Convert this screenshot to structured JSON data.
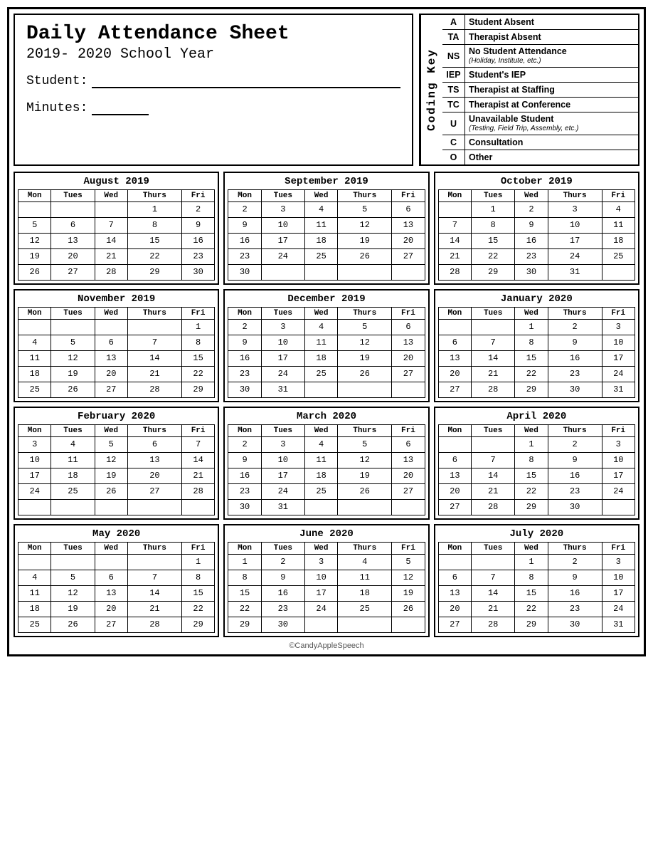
{
  "header": {
    "title": "Daily Attendance Sheet",
    "year": "2019- 2020 School Year",
    "student_label": "Student:",
    "minutes_label": "Minutes:"
  },
  "coding_key": {
    "label": "Coding Key",
    "items": [
      {
        "code": "A",
        "main": "Student Absent",
        "sub": ""
      },
      {
        "code": "TA",
        "main": "Therapist Absent",
        "sub": ""
      },
      {
        "code": "NS",
        "main": "No Student Attendance",
        "sub": "(Holiday, Institute, etc.)"
      },
      {
        "code": "IEP",
        "main": "Student's IEP",
        "sub": ""
      },
      {
        "code": "TS",
        "main": "Therapist at Staffing",
        "sub": ""
      },
      {
        "code": "TC",
        "main": "Therapist at Conference",
        "sub": ""
      },
      {
        "code": "U",
        "main": "Unavailable Student",
        "sub": "(Testing, Field Trip, Assembly, etc.)"
      },
      {
        "code": "C",
        "main": "Consultation",
        "sub": ""
      },
      {
        "code": "O",
        "main": "Other",
        "sub": ""
      }
    ]
  },
  "calendars": [
    {
      "title": "August 2019",
      "days": [
        "Mon",
        "Tues",
        "Wed",
        "Thurs",
        "Fri"
      ],
      "weeks": [
        [
          "",
          "",
          "",
          "1",
          "2"
        ],
        [
          "5",
          "6",
          "7",
          "8",
          "9"
        ],
        [
          "12",
          "13",
          "14",
          "15",
          "16"
        ],
        [
          "19",
          "20",
          "21",
          "22",
          "23"
        ],
        [
          "26",
          "27",
          "28",
          "29",
          "30"
        ]
      ]
    },
    {
      "title": "September 2019",
      "days": [
        "Mon",
        "Tues",
        "Wed",
        "Thurs",
        "Fri"
      ],
      "weeks": [
        [
          "2",
          "3",
          "4",
          "5",
          "6"
        ],
        [
          "9",
          "10",
          "11",
          "12",
          "13"
        ],
        [
          "16",
          "17",
          "18",
          "19",
          "20"
        ],
        [
          "23",
          "24",
          "25",
          "26",
          "27"
        ],
        [
          "30",
          "",
          "",
          "",
          ""
        ]
      ]
    },
    {
      "title": "October 2019",
      "days": [
        "Mon",
        "Tues",
        "Wed",
        "Thurs",
        "Fri"
      ],
      "weeks": [
        [
          "",
          "1",
          "2",
          "3",
          "4"
        ],
        [
          "7",
          "8",
          "9",
          "10",
          "11"
        ],
        [
          "14",
          "15",
          "16",
          "17",
          "18"
        ],
        [
          "21",
          "22",
          "23",
          "24",
          "25"
        ],
        [
          "28",
          "29",
          "30",
          "31",
          ""
        ]
      ]
    },
    {
      "title": "November 2019",
      "days": [
        "Mon",
        "Tues",
        "Wed",
        "Thurs",
        "Fri"
      ],
      "weeks": [
        [
          "",
          "",
          "",
          "",
          "1"
        ],
        [
          "4",
          "5",
          "6",
          "7",
          "8"
        ],
        [
          "11",
          "12",
          "13",
          "14",
          "15"
        ],
        [
          "18",
          "19",
          "20",
          "21",
          "22"
        ],
        [
          "25",
          "26",
          "27",
          "28",
          "29"
        ]
      ]
    },
    {
      "title": "December 2019",
      "days": [
        "Mon",
        "Tues",
        "Wed",
        "Thurs",
        "Fri"
      ],
      "weeks": [
        [
          "2",
          "3",
          "4",
          "5",
          "6"
        ],
        [
          "9",
          "10",
          "11",
          "12",
          "13"
        ],
        [
          "16",
          "17",
          "18",
          "19",
          "20"
        ],
        [
          "23",
          "24",
          "25",
          "26",
          "27"
        ],
        [
          "30",
          "31",
          "",
          "",
          ""
        ]
      ]
    },
    {
      "title": "January 2020",
      "days": [
        "Mon",
        "Tues",
        "Wed",
        "Thurs",
        "Fri"
      ],
      "weeks": [
        [
          "",
          "",
          "1",
          "2",
          "3"
        ],
        [
          "6",
          "7",
          "8",
          "9",
          "10"
        ],
        [
          "13",
          "14",
          "15",
          "16",
          "17"
        ],
        [
          "20",
          "21",
          "22",
          "23",
          "24"
        ],
        [
          "27",
          "28",
          "29",
          "30",
          "31"
        ]
      ]
    },
    {
      "title": "February 2020",
      "days": [
        "Mon",
        "Tues",
        "Wed",
        "Thurs",
        "Fri"
      ],
      "weeks": [
        [
          "3",
          "4",
          "5",
          "6",
          "7"
        ],
        [
          "10",
          "11",
          "12",
          "13",
          "14"
        ],
        [
          "17",
          "18",
          "19",
          "20",
          "21"
        ],
        [
          "24",
          "25",
          "26",
          "27",
          "28"
        ],
        [
          "",
          "",
          "",
          "",
          ""
        ]
      ]
    },
    {
      "title": "March 2020",
      "days": [
        "Mon",
        "Tues",
        "Wed",
        "Thurs",
        "Fri"
      ],
      "weeks": [
        [
          "2",
          "3",
          "4",
          "5",
          "6"
        ],
        [
          "9",
          "10",
          "11",
          "12",
          "13"
        ],
        [
          "16",
          "17",
          "18",
          "19",
          "20"
        ],
        [
          "23",
          "24",
          "25",
          "26",
          "27"
        ],
        [
          "30",
          "31",
          "",
          "",
          ""
        ]
      ]
    },
    {
      "title": "April 2020",
      "days": [
        "Mon",
        "Tues",
        "Wed",
        "Thurs",
        "Fri"
      ],
      "weeks": [
        [
          "",
          "",
          "1",
          "2",
          "3"
        ],
        [
          "6",
          "7",
          "8",
          "9",
          "10"
        ],
        [
          "13",
          "14",
          "15",
          "16",
          "17"
        ],
        [
          "20",
          "21",
          "22",
          "23",
          "24"
        ],
        [
          "27",
          "28",
          "29",
          "30",
          ""
        ]
      ]
    },
    {
      "title": "May 2020",
      "days": [
        "Mon",
        "Tues",
        "Wed",
        "Thurs",
        "Fri"
      ],
      "weeks": [
        [
          "",
          "",
          "",
          "",
          "1"
        ],
        [
          "4",
          "5",
          "6",
          "7",
          "8"
        ],
        [
          "11",
          "12",
          "13",
          "14",
          "15"
        ],
        [
          "18",
          "19",
          "20",
          "21",
          "22"
        ],
        [
          "25",
          "26",
          "27",
          "28",
          "29"
        ]
      ]
    },
    {
      "title": "June 2020",
      "days": [
        "Mon",
        "Tues",
        "Wed",
        "Thurs",
        "Fri"
      ],
      "weeks": [
        [
          "1",
          "2",
          "3",
          "4",
          "5"
        ],
        [
          "8",
          "9",
          "10",
          "11",
          "12"
        ],
        [
          "15",
          "16",
          "17",
          "18",
          "19"
        ],
        [
          "22",
          "23",
          "24",
          "25",
          "26"
        ],
        [
          "29",
          "30",
          "",
          "",
          ""
        ]
      ]
    },
    {
      "title": "July 2020",
      "days": [
        "Mon",
        "Tues",
        "Wed",
        "Thurs",
        "Fri"
      ],
      "weeks": [
        [
          "",
          "",
          "1",
          "2",
          "3"
        ],
        [
          "6",
          "7",
          "8",
          "9",
          "10"
        ],
        [
          "13",
          "14",
          "15",
          "16",
          "17"
        ],
        [
          "20",
          "21",
          "22",
          "23",
          "24"
        ],
        [
          "27",
          "28",
          "29",
          "30",
          "31"
        ]
      ]
    }
  ],
  "footer": "©CandyAppleSpeech"
}
